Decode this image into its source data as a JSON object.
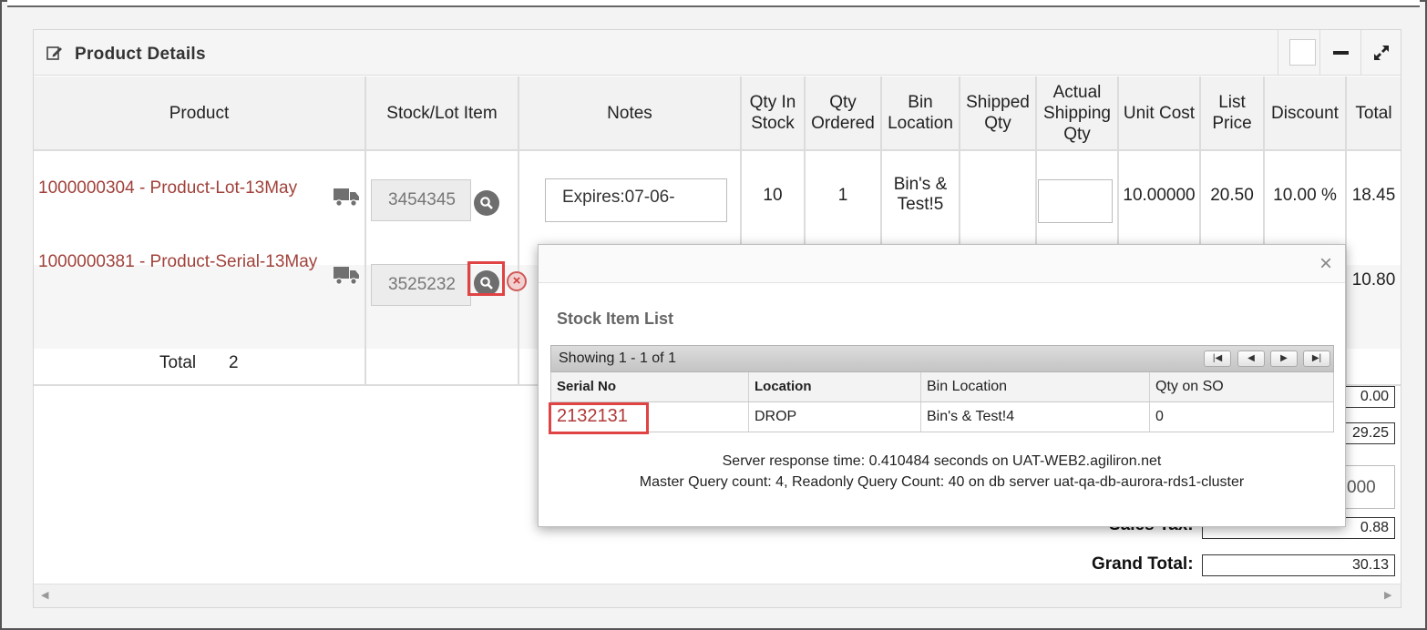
{
  "panel": {
    "title": "Product Details"
  },
  "table": {
    "headers": {
      "product": "Product",
      "stock_lot": "Stock/Lot Item",
      "notes": "Notes",
      "qty_in_stock": "Qty In Stock",
      "qty_ordered": "Qty Ordered",
      "bin_location": "Bin Location",
      "shipped_qty": "Shipped Qty",
      "actual_shipping_qty": "Actual Shipping Qty",
      "unit_cost": "Unit Cost",
      "list_price": "List Price",
      "discount": "Discount",
      "total": "Total"
    },
    "rows": [
      {
        "product": "1000000304 - Product-Lot-13May",
        "stock_lot": "3454345",
        "notes": "Expires:07-06-",
        "qty_in_stock": "10",
        "qty_ordered": "1",
        "bin_location": "Bin's & Test!5",
        "unit_cost": "10.00000",
        "list_price": "20.50",
        "discount": "10.00 %",
        "total": "18.45"
      },
      {
        "product": "1000000381 - Product-Serial-13May",
        "stock_lot": "3525232",
        "total": "10.80"
      }
    ],
    "total_label": "Total",
    "total_count": "2"
  },
  "summary": {
    "box1": "0.00",
    "box2": "29.25",
    "box3": "000",
    "sales_tax_label": "Sales Tax:",
    "sales_tax": "0.88",
    "grand_total_label": "Grand Total:",
    "grand_total": "30.13"
  },
  "popup": {
    "close": "×",
    "heading": "Stock Item List",
    "pager_text": "Showing 1 - 1 of 1",
    "columns": [
      "Serial No",
      "Location",
      "Bin Location",
      "Qty on SO"
    ],
    "rows": [
      {
        "serial_no": "2132131",
        "location": "DROP",
        "bin_location": "Bin's & Test!4",
        "qty_on_so": "0"
      }
    ],
    "server_response": "Server response time: 0.410484 seconds on UAT-WEB2.agiliron.net",
    "query_count": "Master Query count: 4, Readonly Query Count: 40 on db server uat-qa-db-aurora-rds1-cluster"
  },
  "colors": {
    "link": "#a0413a",
    "highlight": "#e04343"
  }
}
